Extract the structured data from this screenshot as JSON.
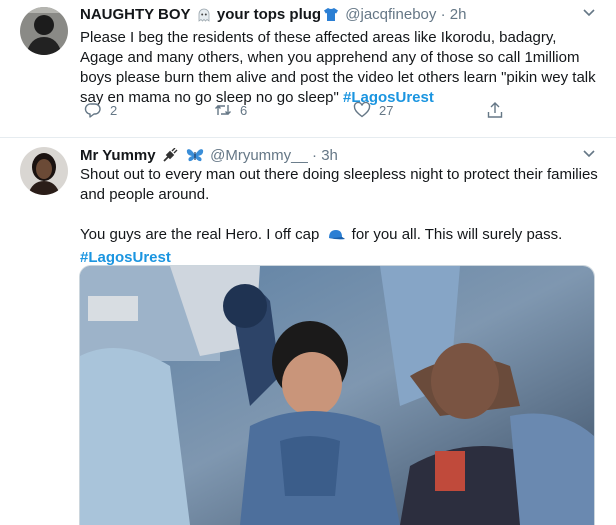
{
  "tweets": [
    {
      "name": "NAUGHTY BOY",
      "name_suffix": "your tops plug",
      "handle": "@jacqfineboy",
      "dot": "·",
      "time": "2h",
      "text": "Please I beg the residents of these  affected areas like Ikorodu, badagry,  Agage and many others, when you apprehend any of those so call 1milliom boys please burn them alive and post the video let others learn \"pikin wey talk say en mama no go sleep no go sleep\"",
      "hashtag": "#LagosUrest",
      "replies": "2",
      "retweets": "6",
      "likes": "27"
    },
    {
      "name": "Mr Yummy",
      "handle": "@Mryummy__",
      "dot": "·",
      "time": "3h",
      "line1": "Shout out to every man out there doing sleepless night to protect their families and people around.",
      "line2a": "You guys are the real Hero. I off cap",
      "line2b": "for you all. This will surely pass.",
      "hashtag": "#LagosUrest"
    }
  ],
  "colors": {
    "accent": "#1b95e0",
    "muted": "#657786",
    "text": "#14171a",
    "divider": "#e6ecf0"
  },
  "icons": [
    "chevron-down-icon",
    "reply-icon",
    "retweet-icon",
    "like-icon",
    "share-icon",
    "ghost-emoji-icon",
    "tshirt-emoji-icon",
    "plug-emoji-icon",
    "butterfly-emoji-icon",
    "cap-emoji-icon"
  ]
}
